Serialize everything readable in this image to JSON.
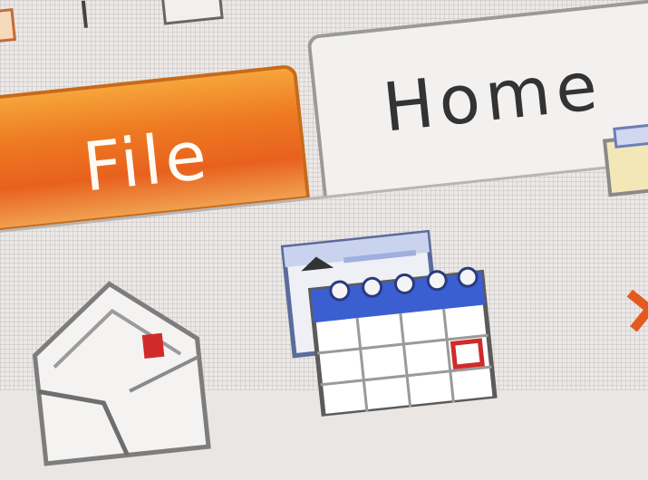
{
  "ribbon": {
    "tabs": [
      {
        "label": "File",
        "active": false,
        "color": "#ee7a22"
      },
      {
        "label": "Home",
        "active": true
      }
    ]
  },
  "icons": {
    "quick_access": [
      "app-icon",
      "separator-icon",
      "quick-access-icon"
    ],
    "ribbon_items": [
      "new-email-icon",
      "new-calendar-item-icon",
      "folder-icon",
      "delete-icon"
    ]
  },
  "colors": {
    "file_tab": "#ee7a22",
    "calendar_accent": "#3b5fd0",
    "marker_red": "#d12a2a"
  }
}
